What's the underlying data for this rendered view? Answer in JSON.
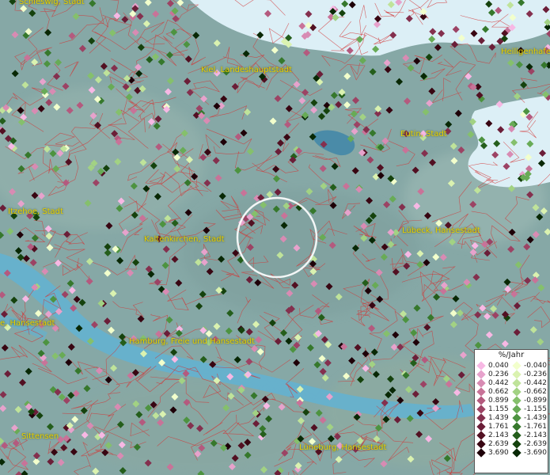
{
  "map": {
    "cities": [
      {
        "name": "Schleswig, Stadt"
      },
      {
        "name": "Kiel, Landeshauptstadt"
      },
      {
        "name": "Heiligenhafen"
      },
      {
        "name": "Eutin, Stadt"
      },
      {
        "name": "Itzehoe, Stadt"
      },
      {
        "name": "Kaltenkirchen, Stadt"
      },
      {
        "name": "Lübeck, Hansestadt"
      },
      {
        "name": "e, Hansestadt"
      },
      {
        "name": "Hamburg, Freie und Hansestadt"
      },
      {
        "name": "Sittensen"
      },
      {
        "name": "Lüneburg, Hansestadt"
      }
    ],
    "colors": {
      "land": "#86a8a6",
      "sea": "#dceff6",
      "river": "#5fb3d6",
      "boundaries": "#d33434"
    }
  },
  "legend": {
    "title": "%/Jahr",
    "positive": [
      {
        "label": "0.040",
        "color": "#f7b8e4"
      },
      {
        "label": "0.236",
        "color": "#e7a2cc"
      },
      {
        "label": "0.442",
        "color": "#d88bb3"
      },
      {
        "label": "0.662",
        "color": "#c87398"
      },
      {
        "label": "0.899",
        "color": "#b45a7e"
      },
      {
        "label": "1.155",
        "color": "#9c4364"
      },
      {
        "label": "1.439",
        "color": "#84304e"
      },
      {
        "label": "1.761",
        "color": "#6b1e38"
      },
      {
        "label": "2.143",
        "color": "#521022"
      },
      {
        "label": "2.639",
        "color": "#380612"
      },
      {
        "label": "3.690",
        "color": "#1e0008"
      }
    ],
    "negative": [
      {
        "label": "-0.040",
        "color": "#f2ffcc"
      },
      {
        "label": "-0.236",
        "color": "#daf2b0"
      },
      {
        "label": "-0.442",
        "color": "#bfe39a"
      },
      {
        "label": "-0.662",
        "color": "#a2d283"
      },
      {
        "label": "-0.899",
        "color": "#85c06c"
      },
      {
        "label": "-1.155",
        "color": "#68ab56"
      },
      {
        "label": "-1.439",
        "color": "#4d9340"
      },
      {
        "label": "-1.761",
        "color": "#36782c"
      },
      {
        "label": "-2.143",
        "color": "#245e1b"
      },
      {
        "label": "-2.639",
        "color": "#15420d"
      },
      {
        "label": "-3.690",
        "color": "#082805"
      }
    ]
  }
}
